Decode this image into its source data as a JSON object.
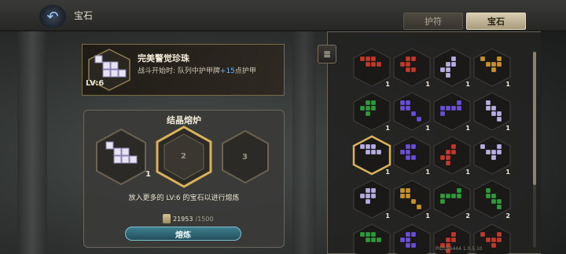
{
  "header": {
    "title": "宝石",
    "tabs": [
      {
        "label": "护符",
        "active": false
      },
      {
        "label": "宝石",
        "active": true
      }
    ]
  },
  "gem_info": {
    "name": "完美警觉珍珠",
    "level": "LV:6",
    "desc_prefix": "战斗开始时: 队列中护甲牌",
    "desc_bonus": "+15",
    "desc_suffix": "点护甲"
  },
  "furnace": {
    "title": "结晶熔炉",
    "slots": [
      {
        "index": "1",
        "filled": true,
        "count": "1"
      },
      {
        "index": "2",
        "filled": false
      },
      {
        "index": "3",
        "filled": false
      }
    ],
    "hint": "放入更多的 LV:6 的宝石以进行熔炼",
    "currency": "21953",
    "currency_max": "/1500",
    "smelt_label": "熔炼"
  },
  "inventory": {
    "gems": [
      {
        "color": "#c0392b",
        "count": "1"
      },
      {
        "color": "#c0392b",
        "count": "1"
      },
      {
        "color": "#b7aee0",
        "count": "1"
      },
      {
        "color": "#c8912a",
        "count": "1"
      },
      {
        "color": "#2f9a3a",
        "count": "1"
      },
      {
        "color": "#6a4fd6",
        "count": "1"
      },
      {
        "color": "#6a4fd6",
        "count": "1"
      },
      {
        "color": "#b7aee0",
        "count": "1"
      },
      {
        "color": "#b7aee0",
        "count": "1"
      },
      {
        "color": "#6a4fd6",
        "count": "1"
      },
      {
        "color": "#c0392b",
        "count": "1"
      },
      {
        "color": "#b7aee0",
        "count": "1"
      },
      {
        "color": "#b7aee0",
        "count": "1"
      },
      {
        "color": "#c8912a",
        "count": "1"
      },
      {
        "color": "#2f9a3a",
        "count": "2"
      },
      {
        "color": "#2f9a3a",
        "count": "2"
      },
      {
        "color": "#2f9a3a",
        "count": ""
      },
      {
        "color": "#6a4fd6",
        "count": ""
      },
      {
        "color": "#c0392b",
        "count": ""
      },
      {
        "color": "#c0392b",
        "count": ""
      }
    ],
    "selected_index": 8
  },
  "watermark": "PID156444 1.0.5.10",
  "colors": {
    "accent_gold": "#d9b25a",
    "button_teal": "#3f7e8f",
    "bonus_blue": "#6fb7ff"
  }
}
